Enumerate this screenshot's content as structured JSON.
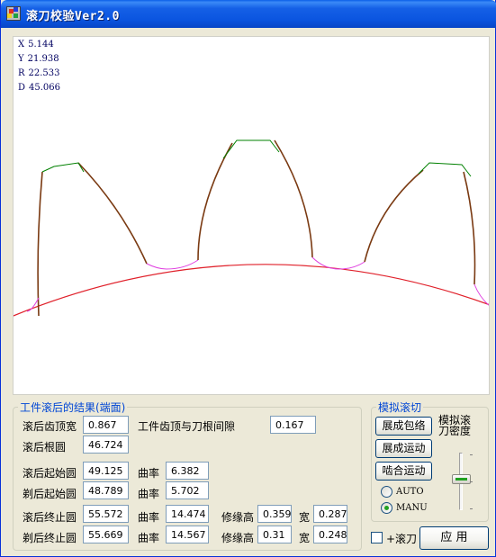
{
  "window": {
    "title": "滚刀校验Ver2.0"
  },
  "readout": {
    "x": {
      "label": "X",
      "value": "5.144"
    },
    "y": {
      "label": "Y",
      "value": "21.938"
    },
    "r": {
      "label": "R",
      "value": "22.533"
    },
    "d": {
      "label": "D",
      "value": "45.066"
    }
  },
  "colors": {
    "gear_profile": "#7a3a12",
    "tip_line": "#008000",
    "root_circle": "#e0202a",
    "fillet": "#e040e0"
  },
  "results": {
    "legend": "工件滚后的结果(端面)",
    "tip_width": {
      "label": "滚后齿顶宽",
      "value": "0.867"
    },
    "clearance": {
      "label": "工件齿顶与刀根间隙",
      "value": "0.167"
    },
    "root_circle": {
      "label": "滚后根圆",
      "value": "46.724"
    },
    "hob_start": {
      "label": "滚后起始圆",
      "value": "49.125",
      "curv_label": "曲率",
      "curv_value": "6.382"
    },
    "shave_start": {
      "label": "剃后起始圆",
      "value": "48.789",
      "curv_label": "曲率",
      "curv_value": "5.702"
    },
    "hob_end": {
      "label": "滚后终止圆",
      "value": "55.572",
      "curv_label": "曲率",
      "curv_value": "14.474",
      "mod_label": "修缘高",
      "mod_value": "0.359",
      "width_label": "宽",
      "width_value": "0.287"
    },
    "shave_end": {
      "label": "剃后终止圆",
      "value": "55.669",
      "curv_label": "曲率",
      "curv_value": "14.567",
      "mod_label": "修缘高",
      "mod_value": "0.31",
      "width_label": "宽",
      "width_value": "0.248"
    }
  },
  "simulation": {
    "legend": "模拟滚切",
    "envelope_button": "展成包络",
    "motion_button": "展成运动",
    "mesh_button": "啮合运动",
    "density_label_1": "模拟滚",
    "density_label_2": "刀密度",
    "density_level": 0.45,
    "radio_auto": "AUTO",
    "radio_manu": "MANU",
    "selected_mode": "MANU"
  },
  "plus_hob_label": "+滚刀",
  "apply_button": "应 用"
}
